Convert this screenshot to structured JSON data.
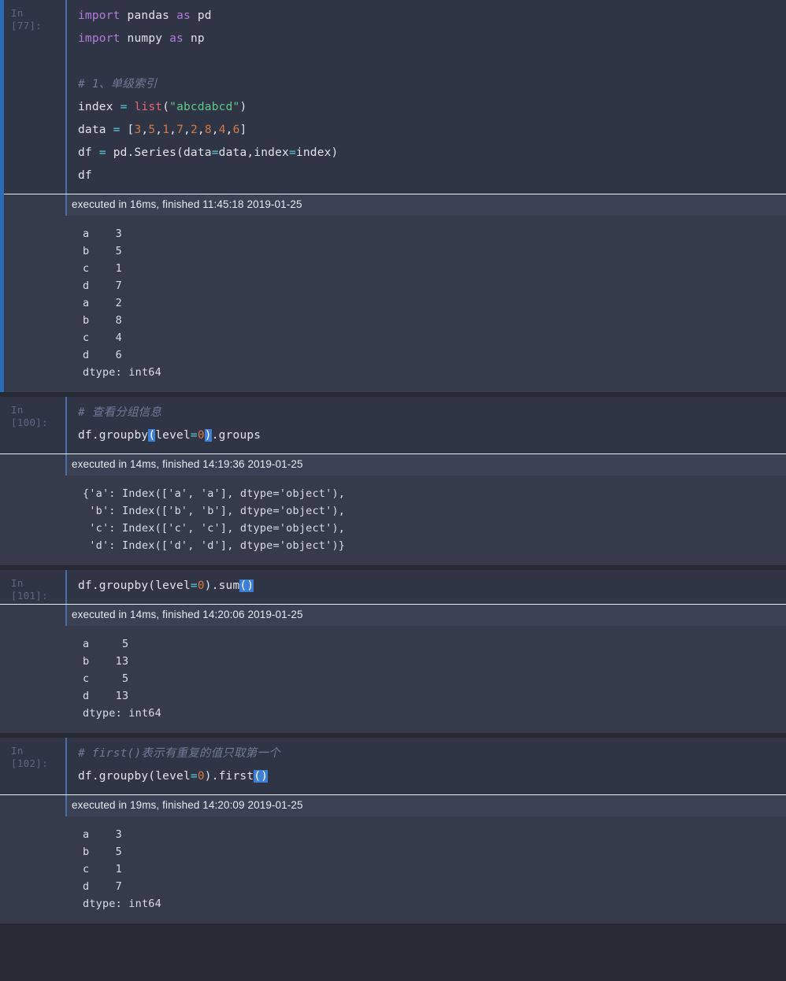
{
  "notebook": {
    "cells": [
      {
        "prompt": "In [77]:",
        "selected": true,
        "code_lines": [
          "import pandas as pd",
          "import numpy as np",
          "",
          "# 1、单级索引",
          "index = list(\"abcdabcd\")",
          "data = [3,5,1,7,2,8,4,6]",
          "df = pd.Series(data=data,index=index)",
          "df"
        ],
        "exec_info": "executed in 16ms, finished 11:45:18 2019-01-25",
        "output": "a    3\nb    5\nc    1\nd    7\na    2\nb    8\nc    4\nd    6\ndtype: int64"
      },
      {
        "prompt": "In [100]:",
        "selected": false,
        "code_lines": [
          "# 查看分组信息",
          "df.groupby(level=0).groups"
        ],
        "exec_info": "executed in 14ms, finished 14:19:36 2019-01-25",
        "output": "{'a': Index(['a', 'a'], dtype='object'),\n 'b': Index(['b', 'b'], dtype='object'),\n 'c': Index(['c', 'c'], dtype='object'),\n 'd': Index(['d', 'd'], dtype='object')}"
      },
      {
        "prompt": "In [101]:",
        "selected": false,
        "code_lines": [
          "df.groupby(level=0).sum()"
        ],
        "exec_info": "executed in 14ms, finished 14:20:06 2019-01-25",
        "output": "a     5\nb    13\nc     5\nd    13\ndtype: int64"
      },
      {
        "prompt": "In [102]:",
        "selected": false,
        "code_lines": [
          "# first()表示有重复的值只取第一个",
          "df.groupby(level=0).first()"
        ],
        "exec_info": "executed in 19ms, finished 14:20:09 2019-01-25",
        "output": "a    3\nb    5\nc    1\nd    7\ndtype: int64"
      }
    ]
  },
  "colors": {
    "page_background": "#252a35",
    "cell_background": "#353b4a",
    "editor_background": "#2f3545",
    "exec_bar_background": "#3a4152",
    "selection_bar": "#2b6cb8",
    "editor_left_border": "#4a6fa5",
    "keyword": "#b07ddb",
    "builtin": "#e9637a",
    "string": "#5fc98a",
    "number": "#d07b4a",
    "operator": "#5fc7d8",
    "comment": "#6f7a94",
    "text": "#dfe3ec",
    "prompt_text": "#5b6681",
    "bracket_highlight": "#3c7fd4"
  }
}
